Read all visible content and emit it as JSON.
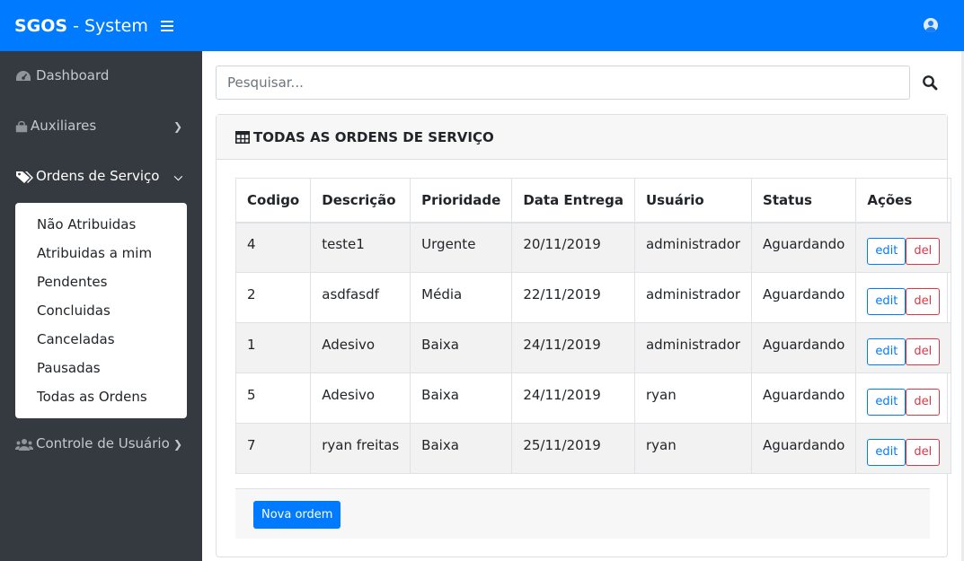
{
  "header": {
    "brand_bold": "SGOS",
    "brand_sep": "-",
    "brand_rest": "System"
  },
  "sidebar": {
    "items": [
      {
        "label": "Dashboard",
        "icon": "tachometer-icon"
      },
      {
        "label": "Auxiliares",
        "icon": "shopping-bag-icon"
      },
      {
        "label": "Ordens de Serviço",
        "icon": "tags-icon"
      },
      {
        "label": "Controle de Usuário",
        "icon": "users-icon"
      }
    ],
    "submenu": [
      "Não Atribuidas",
      "Atribuidas a mim",
      "Pendentes",
      "Concluidas",
      "Canceladas",
      "Pausadas",
      "Todas as Ordens"
    ]
  },
  "search": {
    "placeholder": "Pesquisar..."
  },
  "card": {
    "title": "TODAS AS ORDENS DE SERVIÇO"
  },
  "table": {
    "headers": [
      "Codigo",
      "Descrição",
      "Prioridade",
      "Data Entrega",
      "Usuário",
      "Status",
      "Ações"
    ],
    "rows": [
      [
        "4",
        "teste1",
        "Urgente",
        "20/11/2019",
        "administrador",
        "Aguardando"
      ],
      [
        "2",
        "asdfasdf",
        "Média",
        "22/11/2019",
        "administrador",
        "Aguardando"
      ],
      [
        "1",
        "Adesivo",
        "Baixa",
        "24/11/2019",
        "administrador",
        "Aguardando"
      ],
      [
        "5",
        "Adesivo",
        "Baixa",
        "24/11/2019",
        "ryan",
        "Aguardando"
      ],
      [
        "7",
        "ryan freitas",
        "Baixa",
        "25/11/2019",
        "ryan",
        "Aguardando"
      ]
    ],
    "edit_label": "edit",
    "del_label": "del"
  },
  "footer": {
    "new_button": "Nova ordem"
  },
  "colors": {
    "primary": "#007bff",
    "sidebar_bg": "#343a40",
    "danger": "#dc3545"
  }
}
